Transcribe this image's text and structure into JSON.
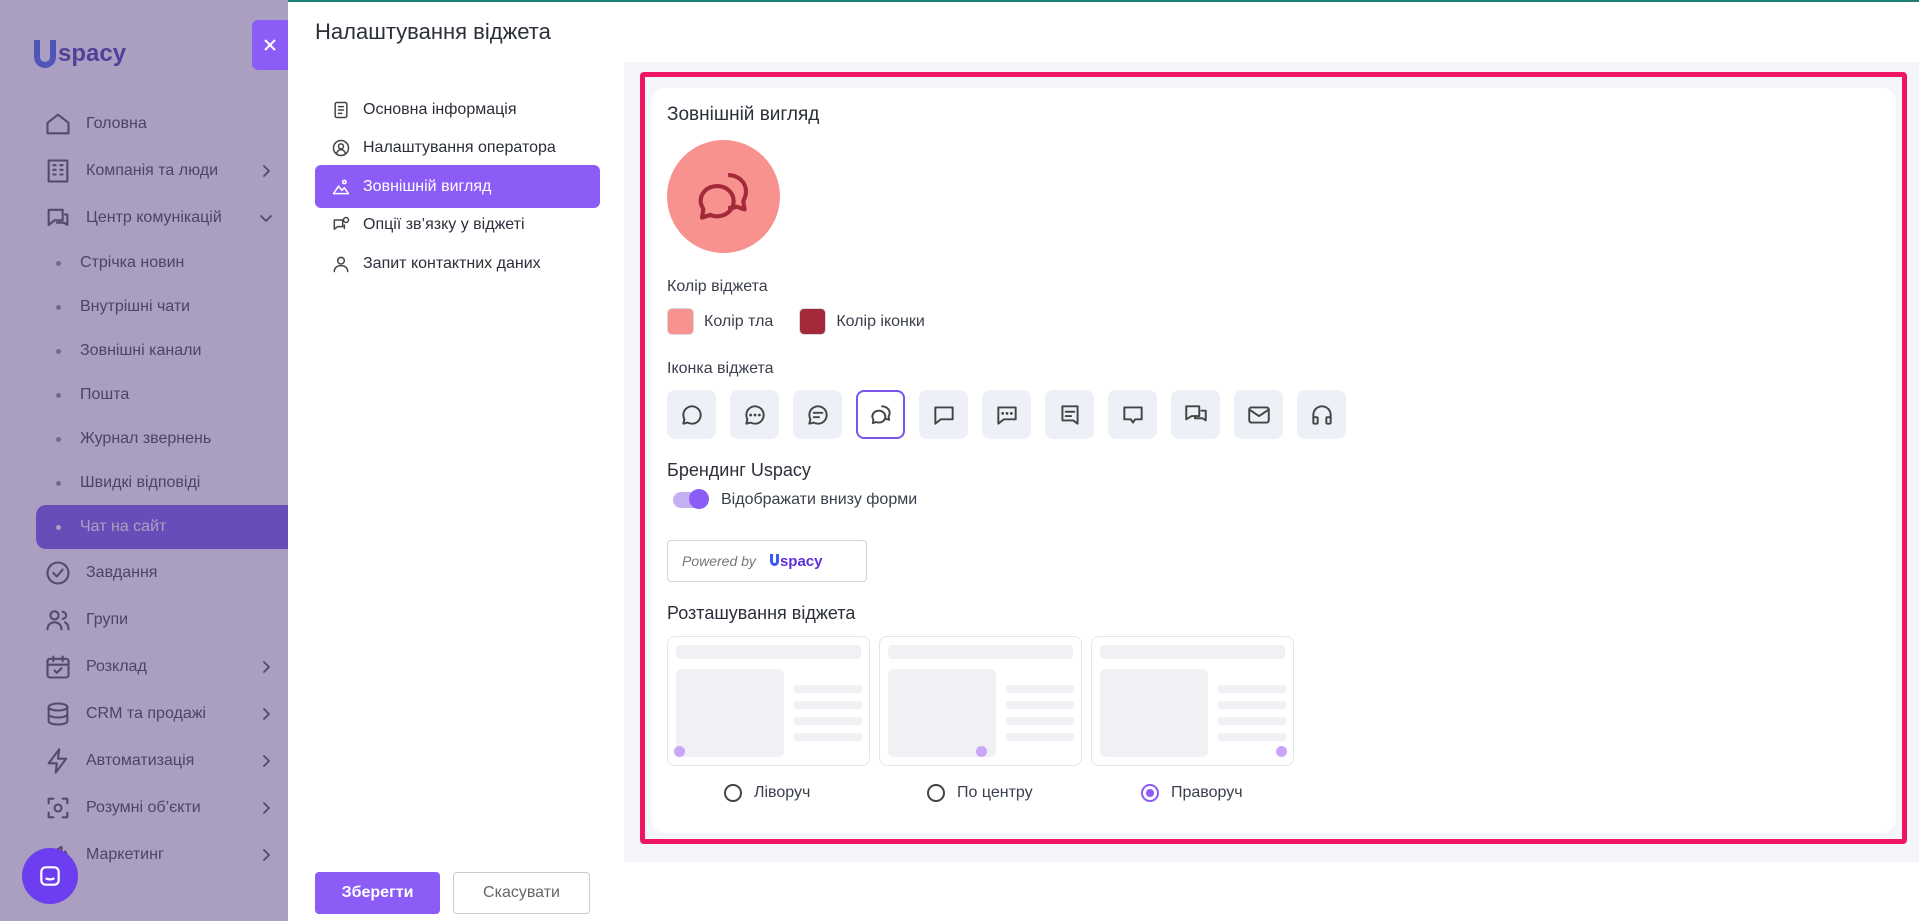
{
  "app": {
    "logo_text": "spacy",
    "nav": [
      {
        "label": "Головна",
        "icon": "home-icon",
        "chevron": false
      },
      {
        "label": "Компанія та люди",
        "icon": "building-icon",
        "chevron": true
      },
      {
        "label": "Центр комунікацій",
        "icon": "communication-icon",
        "chevron": true
      }
    ],
    "sub_items": [
      {
        "label": "Стрічка новин"
      },
      {
        "label": "Внутрішні чати"
      },
      {
        "label": "Зовнішні канали"
      },
      {
        "label": "Пошта"
      },
      {
        "label": "Журнал звернень"
      },
      {
        "label": "Швидкі відповіді"
      },
      {
        "label": "Чат на сайт"
      }
    ],
    "nav_bottom": [
      {
        "label": "Завдання",
        "icon": "task-check-icon",
        "chevron": false
      },
      {
        "label": "Групи",
        "icon": "users-icon",
        "chevron": false
      },
      {
        "label": "Розклад",
        "icon": "calendar-icon",
        "chevron": true
      },
      {
        "label": "CRM та продажі",
        "icon": "database-icon",
        "chevron": true
      },
      {
        "label": "Автоматизація",
        "icon": "lightning-icon",
        "chevron": true
      },
      {
        "label": "Розумні об’єкти",
        "icon": "smart-object-icon",
        "chevron": true
      },
      {
        "label": "Маркетинг",
        "icon": "megaphone-icon",
        "chevron": true
      }
    ]
  },
  "panel": {
    "title": "Налаштування віджета",
    "menu": [
      {
        "label": "Основна інформація",
        "icon": "document-icon"
      },
      {
        "label": "Налаштування оператора",
        "icon": "operator-icon"
      },
      {
        "label": "Зовнішній вигляд",
        "icon": "appearance-icon"
      },
      {
        "label": "Опції зв’язку у віджеті",
        "icon": "chat-options-icon"
      },
      {
        "label": "Запит контактних даних",
        "icon": "contact-icon"
      }
    ],
    "active_menu_index": 2
  },
  "appearance": {
    "title": "Зовнішній вигляд",
    "widget_color_label": "Колір віджета",
    "bg_color_label": "Колір тла",
    "bg_color": "#f8928f",
    "icon_color_label": "Колір іконки",
    "icon_color": "#a4293a",
    "widget_icon_label": "Іконка віджета",
    "icons": [
      "chat-round-icon",
      "chat-dots-icon",
      "chat-lines-icon",
      "chat-double-icon",
      "chat-square-icon",
      "chat-square-dots-icon",
      "chat-square-lines-icon",
      "chat-heart-icon",
      "chat-multi-icon",
      "mail-icon",
      "headphones-icon"
    ],
    "selected_icon_index": 3,
    "branding_title": "Брендинг Uspacy",
    "branding_toggle_label": "Відображати внизу форми",
    "branding_toggle_on": true,
    "powered_by": "Powered by",
    "powered_brand": "spacy",
    "position_title": "Розташування віджета",
    "positions": [
      {
        "label": "Ліворуч"
      },
      {
        "label": "По центру"
      },
      {
        "label": "Праворуч"
      }
    ],
    "selected_position_index": 2
  },
  "footer": {
    "save_label": "Зберегти",
    "cancel_label": "Скасувати"
  },
  "colors": {
    "accent": "#8b5cf6",
    "highlight_frame": "#ee1661"
  }
}
